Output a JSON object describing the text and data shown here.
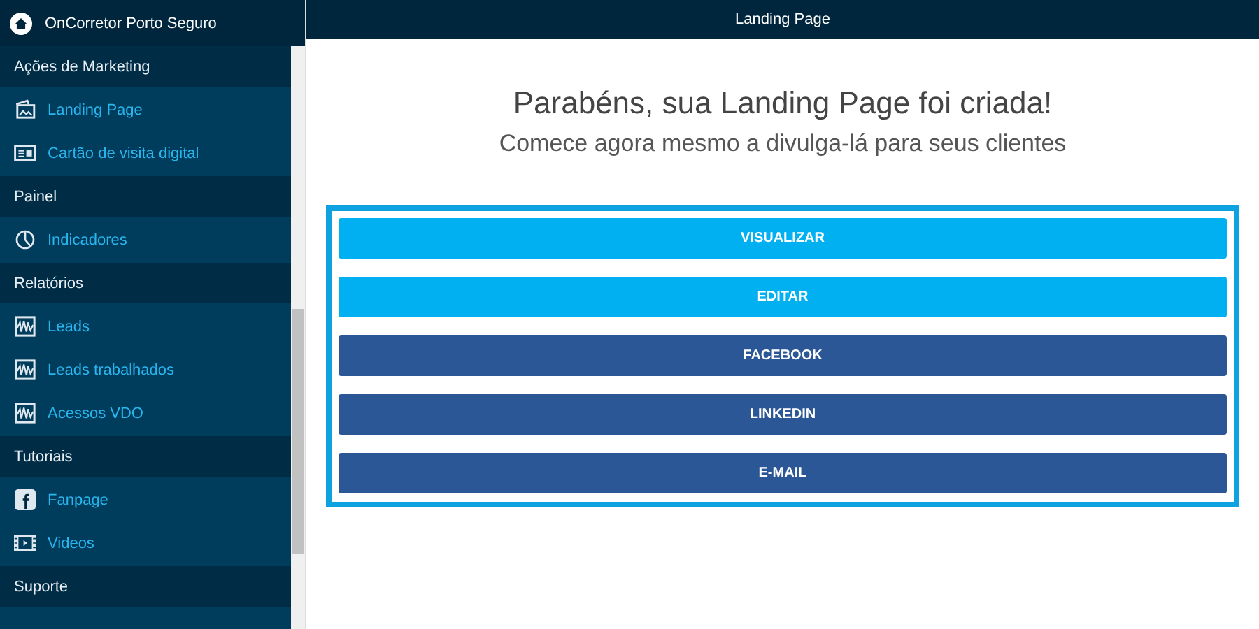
{
  "sidebar": {
    "brand": "OnCorretor Porto Seguro",
    "sections": [
      {
        "title": "Ações de Marketing",
        "items": [
          {
            "label": "Landing Page"
          },
          {
            "label": "Cartão de visita digital"
          }
        ]
      },
      {
        "title": "Painel",
        "items": [
          {
            "label": "Indicadores"
          }
        ]
      },
      {
        "title": "Relatórios",
        "items": [
          {
            "label": "Leads"
          },
          {
            "label": "Leads trabalhados"
          },
          {
            "label": "Acessos VDO"
          }
        ]
      },
      {
        "title": "Tutoriais",
        "items": [
          {
            "label": "Fanpage"
          },
          {
            "label": "Videos"
          }
        ]
      },
      {
        "title": "Suporte"
      }
    ]
  },
  "header": {
    "title": "Landing Page"
  },
  "main": {
    "heading": "Parabéns, sua Landing Page foi criada!",
    "subheading": "Comece agora mesmo a divulga-lá para seus clientes",
    "buttons": [
      {
        "label": "VISUALIZAR",
        "kind": "primary"
      },
      {
        "label": "EDITAR",
        "kind": "primary"
      },
      {
        "label": "FACEBOOK",
        "kind": "share"
      },
      {
        "label": "LINKEDIN",
        "kind": "share"
      },
      {
        "label": "E-MAIL",
        "kind": "share"
      }
    ]
  }
}
